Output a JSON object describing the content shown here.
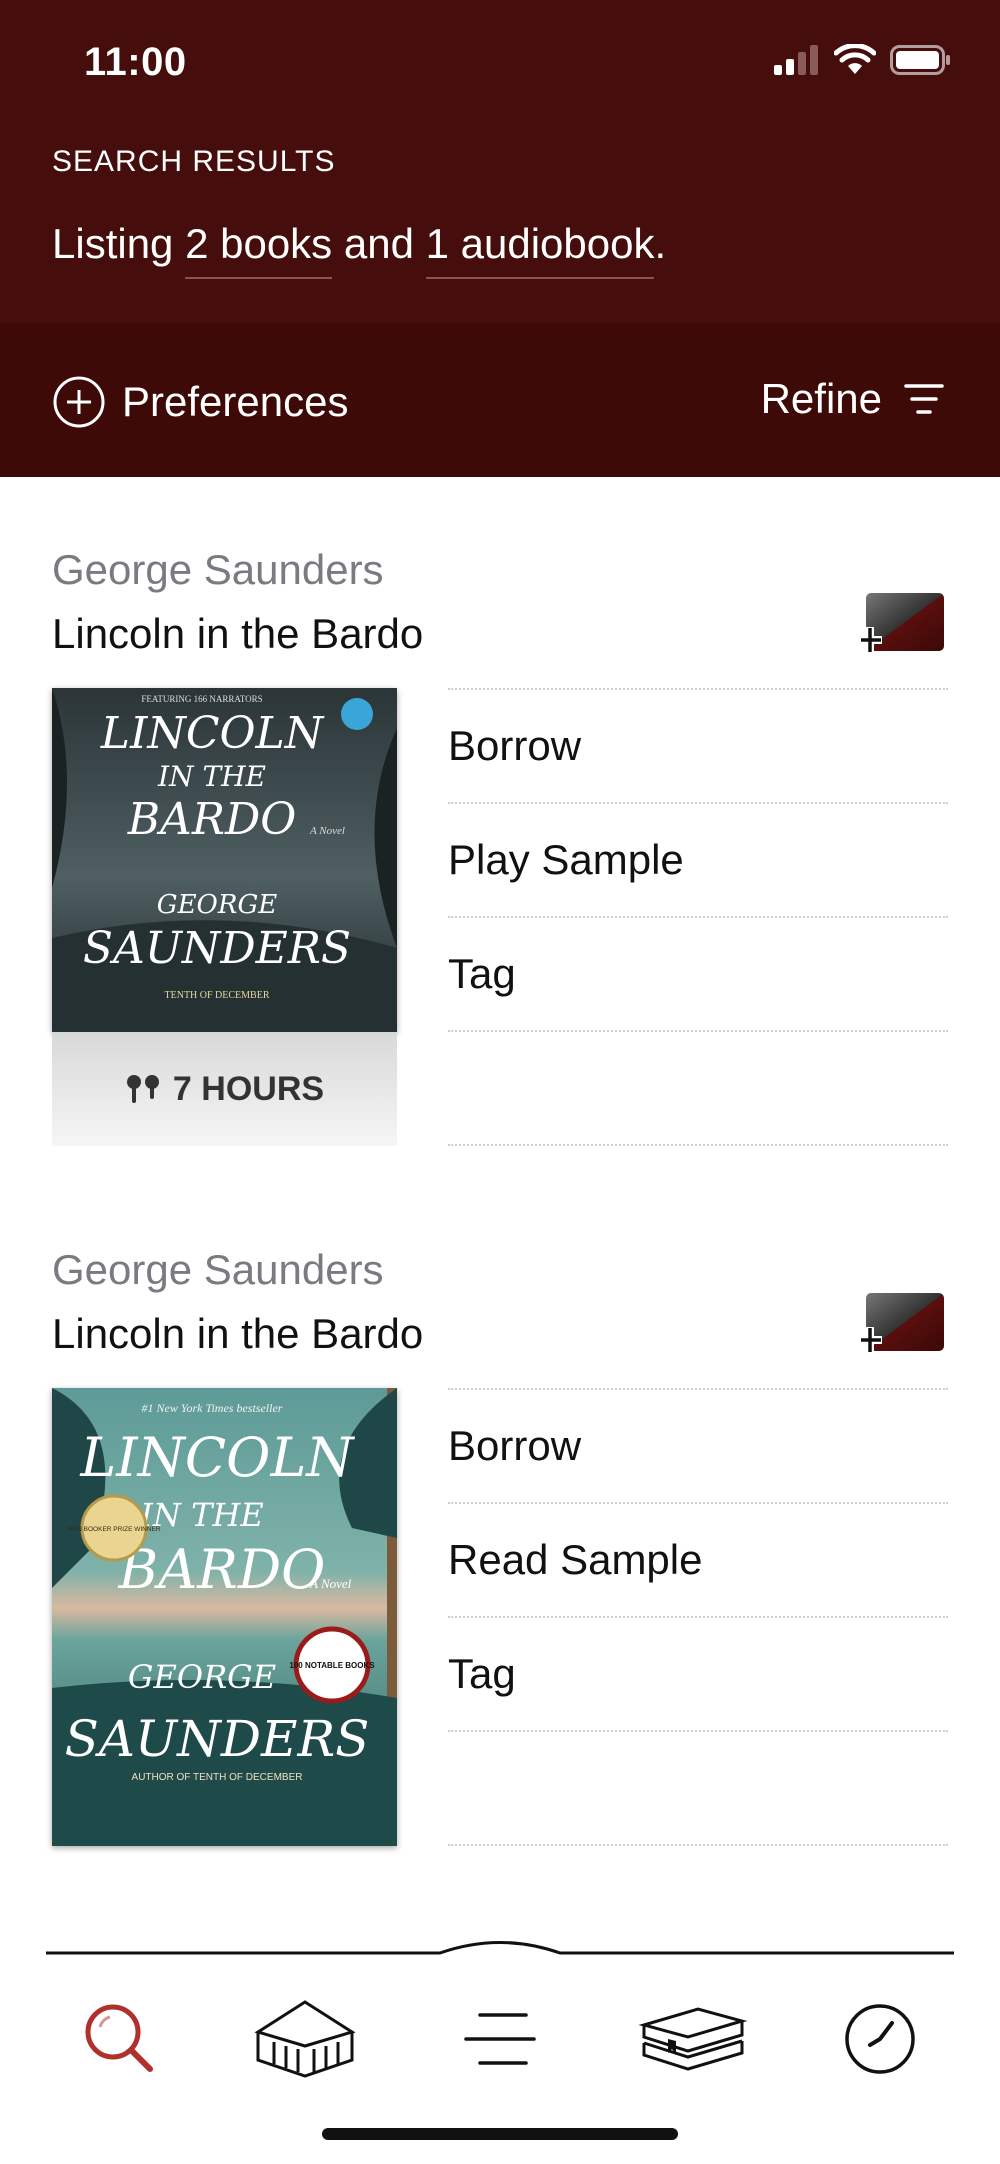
{
  "status": {
    "time": "11:00"
  },
  "header": {
    "section_label": "SEARCH RESULTS",
    "listing": {
      "prefix": "Listing ",
      "books": "2 books",
      "middle": " and ",
      "audiobooks": "1 audiobook",
      "suffix": "."
    }
  },
  "toolbar": {
    "preferences_label": "Preferences",
    "refine_label": "Refine"
  },
  "results": [
    {
      "author": "George Saunders",
      "title": "Lincoln in the Bardo",
      "format": "audiobook",
      "duration": "7 HOURS",
      "cover_text": [
        "FEATURING 166 NARRATORS",
        "LINCOLN",
        "IN THE",
        "BARDO",
        "A Novel",
        "GEORGE",
        "SAUNDERS",
        "TENTH OF DECEMBER"
      ],
      "actions": [
        "Borrow",
        "Play Sample",
        "Tag"
      ]
    },
    {
      "author": "George Saunders",
      "title": "Lincoln in the Bardo",
      "format": "ebook",
      "cover_text": [
        "#1 New York Times bestseller",
        "LINCOLN",
        "IN THE",
        "BARDO",
        "A Novel",
        "GEORGE",
        "SAUNDERS",
        "MAN BOOKER PRIZE WINNER",
        "100 NOTABLE BOOKS",
        "AUTHOR OF TENTH OF DECEMBER"
      ],
      "actions": [
        "Borrow",
        "Read Sample",
        "Tag"
      ]
    }
  ],
  "tabbar": {
    "tabs": [
      {
        "icon": "search-icon",
        "active": true
      },
      {
        "icon": "library-icon",
        "active": false
      },
      {
        "icon": "menu-icon",
        "active": false
      },
      {
        "icon": "shelf-icon",
        "active": false
      },
      {
        "icon": "clock-icon",
        "active": false
      }
    ]
  },
  "colors": {
    "header_bg": "#450d0b",
    "toolbar_bg": "#3e0a08",
    "active_tab": "#b0302c",
    "muted_text": "#7a7a80"
  }
}
